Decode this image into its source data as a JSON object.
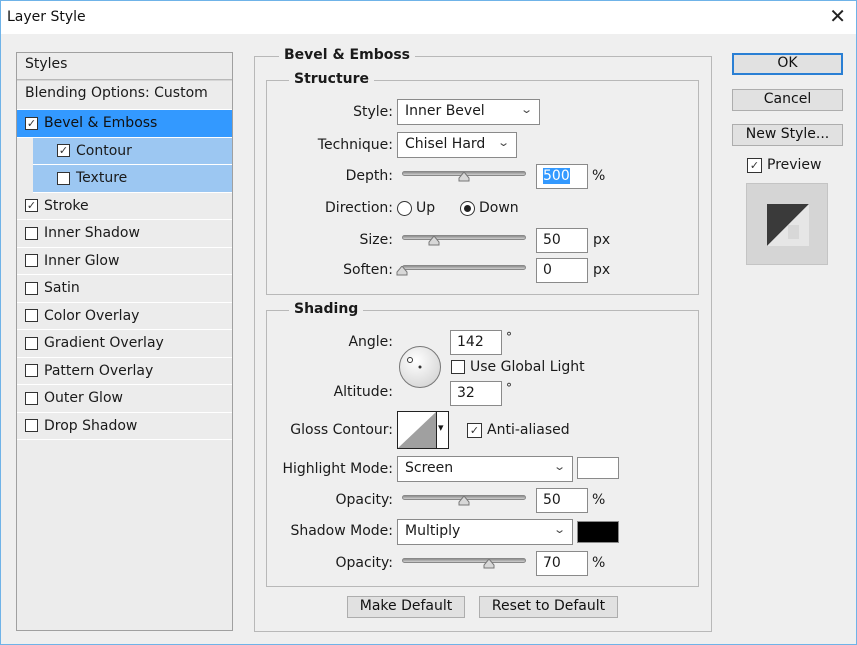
{
  "window": {
    "title": "Layer Style"
  },
  "styles_panel": {
    "header": "Styles",
    "blending_options": "Blending Options: Custom",
    "items": [
      {
        "label": "Bevel & Emboss",
        "checked": true,
        "state": "selected",
        "sub": false
      },
      {
        "label": "Contour",
        "checked": true,
        "state": "subselected",
        "sub": true
      },
      {
        "label": "Texture",
        "checked": false,
        "state": "subselected",
        "sub": true
      },
      {
        "label": "Stroke",
        "checked": true,
        "state": "normal",
        "sub": false
      },
      {
        "label": "Inner Shadow",
        "checked": false,
        "state": "normal",
        "sub": false
      },
      {
        "label": "Inner Glow",
        "checked": false,
        "state": "normal",
        "sub": false
      },
      {
        "label": "Satin",
        "checked": false,
        "state": "normal",
        "sub": false
      },
      {
        "label": "Color Overlay",
        "checked": false,
        "state": "normal",
        "sub": false
      },
      {
        "label": "Gradient Overlay",
        "checked": false,
        "state": "normal",
        "sub": false
      },
      {
        "label": "Pattern Overlay",
        "checked": false,
        "state": "normal",
        "sub": false
      },
      {
        "label": "Outer Glow",
        "checked": false,
        "state": "normal",
        "sub": false
      },
      {
        "label": "Drop Shadow",
        "checked": false,
        "state": "normal",
        "sub": false
      }
    ]
  },
  "bevel": {
    "title": "Bevel & Emboss",
    "structure": {
      "title": "Structure",
      "style_label": "Style:",
      "style_value": "Inner Bevel",
      "technique_label": "Technique:",
      "technique_value": "Chisel Hard",
      "depth_label": "Depth:",
      "depth_value": "500",
      "depth_unit": "%",
      "depth_slider": 0.5,
      "direction_label": "Direction:",
      "direction_up": "Up",
      "direction_down": "Down",
      "direction_selected": "Down",
      "size_label": "Size:",
      "size_value": "50",
      "size_unit": "px",
      "size_slider": 0.26,
      "soften_label": "Soften:",
      "soften_value": "0",
      "soften_unit": "px",
      "soften_slider": 0.0
    },
    "shading": {
      "title": "Shading",
      "angle_label": "Angle:",
      "angle_value": "142",
      "degree_symbol": "°",
      "use_global_light_label": "Use Global Light",
      "use_global_light_checked": false,
      "altitude_label": "Altitude:",
      "altitude_value": "32",
      "gloss_contour_label": "Gloss Contour:",
      "anti_aliased_label": "Anti-aliased",
      "anti_aliased_checked": true,
      "highlight_mode_label": "Highlight Mode:",
      "highlight_mode_value": "Screen",
      "highlight_color": "#ffffff",
      "highlight_opacity_label": "Opacity:",
      "highlight_opacity_value": "50",
      "highlight_opacity_slider": 0.5,
      "shadow_mode_label": "Shadow Mode:",
      "shadow_mode_value": "Multiply",
      "shadow_color": "#000000",
      "shadow_opacity_label": "Opacity:",
      "shadow_opacity_value": "70",
      "shadow_opacity_slider": 0.7,
      "percent_unit": "%"
    },
    "make_default": "Make Default",
    "reset_default": "Reset to Default"
  },
  "actions": {
    "ok": "OK",
    "cancel": "Cancel",
    "new_style": "New Style...",
    "preview_label": "Preview",
    "preview_checked": true
  },
  "icons": {
    "close": "✕",
    "check": "✓",
    "chevron_down": "⌄",
    "dropdown_arrow": "▾"
  }
}
